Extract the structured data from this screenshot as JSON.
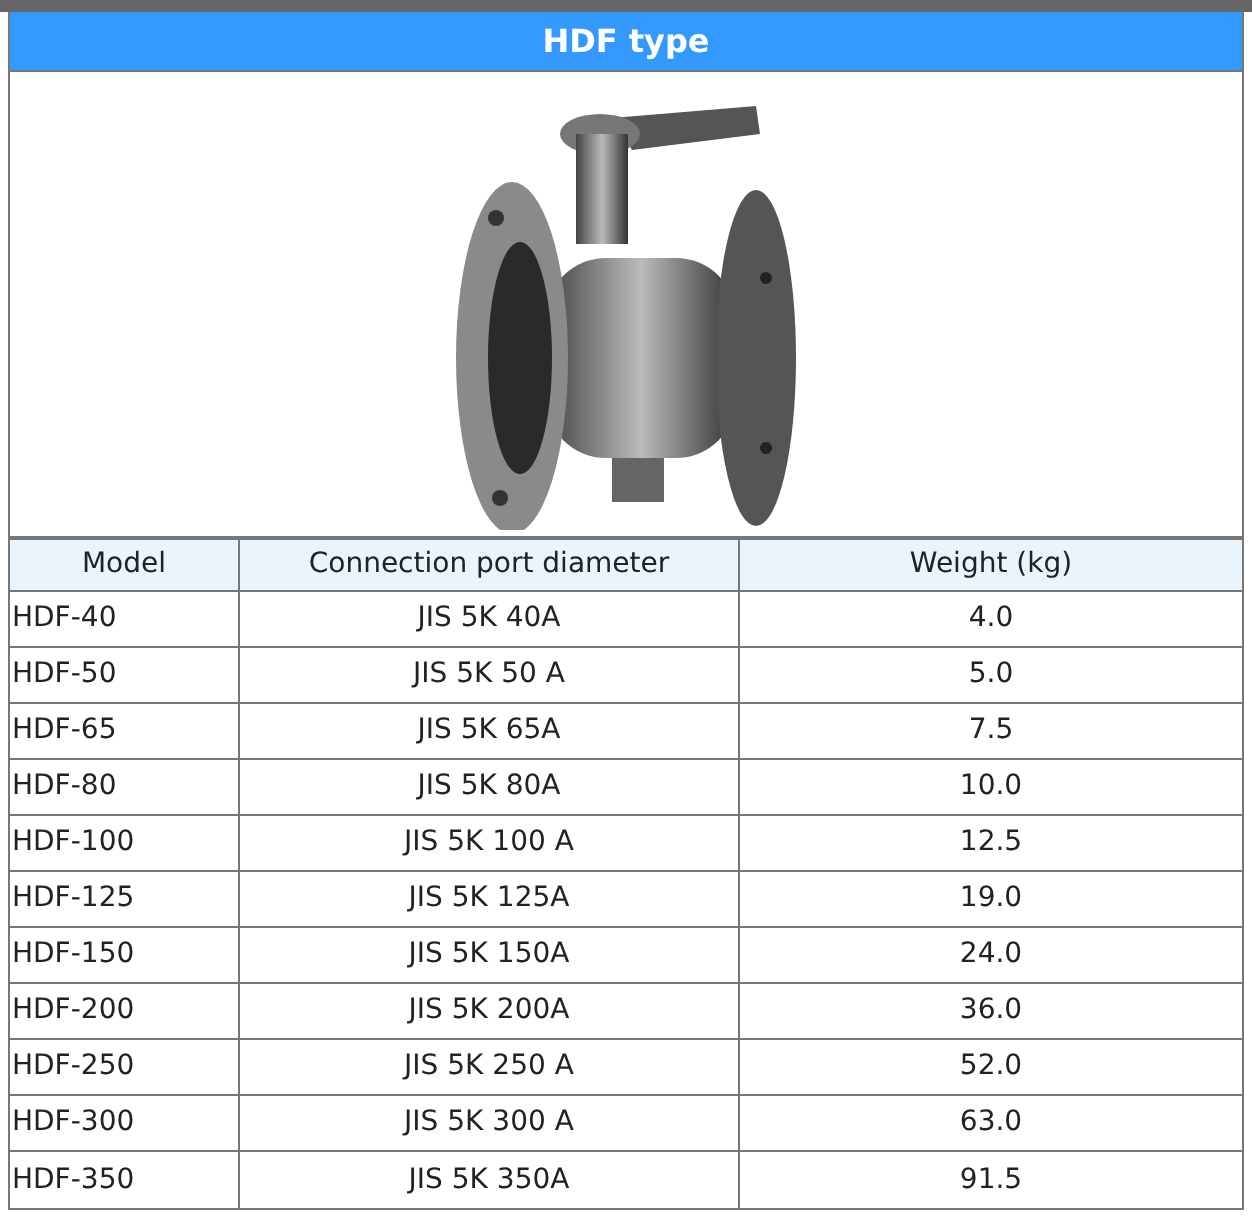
{
  "title": "HDF type",
  "table": {
    "columns": [
      "Model",
      "Connection port diameter",
      "Weight (kg)"
    ],
    "rows": [
      [
        "HDF-40",
        "JIS 5K 40A",
        "4.0"
      ],
      [
        "HDF-50",
        "JIS 5K 50 A",
        "5.0"
      ],
      [
        "HDF-65",
        "JIS 5K 65A",
        "7.5"
      ],
      [
        "HDF-80",
        "JIS 5K 80A",
        "10.0"
      ],
      [
        "HDF-100",
        "JIS 5K 100 A",
        "12.5"
      ],
      [
        "HDF-125",
        "JIS 5K 125A",
        "19.0"
      ],
      [
        "HDF-150",
        "JIS 5K 150A",
        "24.0"
      ],
      [
        "HDF-200",
        "JIS 5K 200A",
        "36.0"
      ],
      [
        "HDF-250",
        "JIS 5K 250 A",
        "52.0"
      ],
      [
        "HDF-300",
        "JIS 5K 300 A",
        "63.0"
      ],
      [
        "HDF-350",
        "JIS 5K 350A",
        "91.5"
      ]
    ]
  }
}
